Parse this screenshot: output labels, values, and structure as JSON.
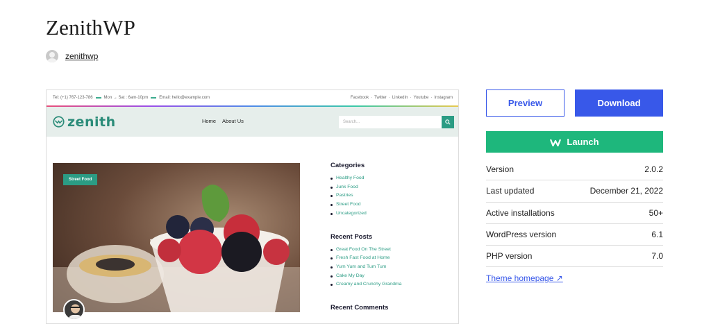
{
  "theme": {
    "title": "ZenithWP",
    "author": "zenithwp"
  },
  "preview": {
    "topbar": {
      "phone": "Tel: (+1) 767-123-786",
      "hours": "Mon → Sat : 6am-10pm",
      "email": "Email: hello@example.com",
      "social": [
        "Facebook",
        "·",
        "Twitter",
        "·",
        "LinkedIn",
        "·",
        "Youtube",
        "·",
        "Instagram"
      ]
    },
    "logo": "zenith",
    "nav": [
      "Home",
      "About Us"
    ],
    "search_placeholder": "Search...",
    "post_badge": "Street Food",
    "sidebar": {
      "categories_title": "Categories",
      "categories": [
        "Healthy Food",
        "Junk Food",
        "Pastries",
        "Street Food",
        "Uncategorized"
      ],
      "recent_posts_title": "Recent Posts",
      "recent_posts": [
        "Great Food On The Street",
        "Fresh Fast Food at Home",
        "Yum Yum and Tum Tum",
        "Cake My Day",
        "Creamy and Crunchy Grandma"
      ],
      "recent_comments_title": "Recent Comments"
    }
  },
  "actions": {
    "preview": "Preview",
    "download": "Download",
    "launch": "Launch"
  },
  "meta": [
    {
      "label": "Version",
      "value": "2.0.2"
    },
    {
      "label": "Last updated",
      "value": "December 21, 2022"
    },
    {
      "label": "Active installations",
      "value": "50+"
    },
    {
      "label": "WordPress version",
      "value": "6.1"
    },
    {
      "label": "PHP version",
      "value": "7.0"
    }
  ],
  "homepage_link": "Theme homepage ↗",
  "colors": {
    "accent": "#3858e9",
    "launch": "#1eb77c",
    "site_teal": "#2b9c84"
  }
}
